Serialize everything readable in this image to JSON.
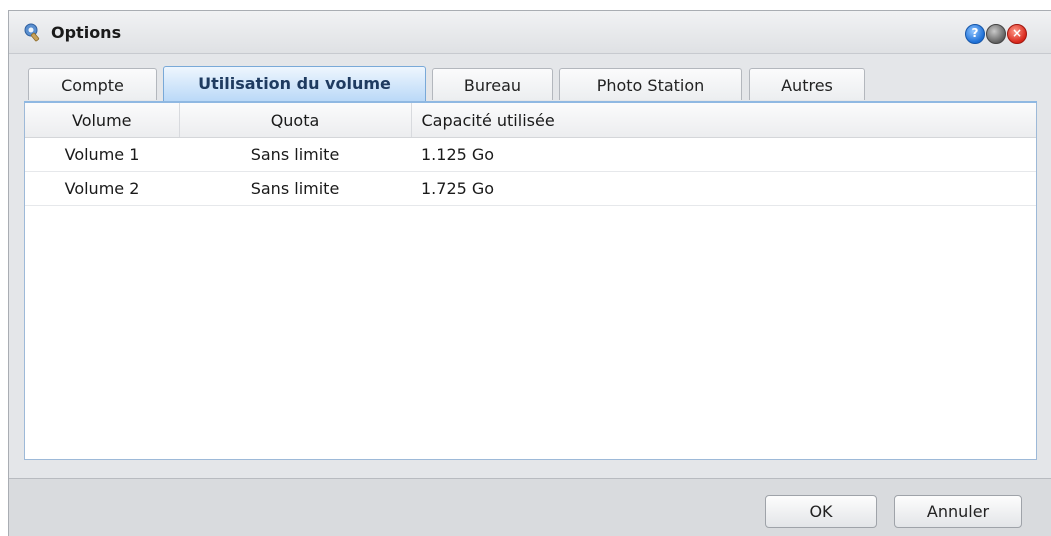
{
  "window": {
    "title": "Options",
    "help_glyph": "?",
    "close_glyph": "×"
  },
  "tabs": [
    {
      "label": "Compte",
      "active": false
    },
    {
      "label": "Utilisation du volume",
      "active": true
    },
    {
      "label": "Bureau",
      "active": false
    },
    {
      "label": "Photo Station",
      "active": false
    },
    {
      "label": "Autres",
      "active": false
    }
  ],
  "table": {
    "headers": [
      "Volume",
      "Quota",
      "Capacité utilisée"
    ],
    "rows": [
      [
        "Volume 1",
        "Sans limite",
        "1.125 Go"
      ],
      [
        "Volume 2",
        "Sans limite",
        "1.725 Go"
      ]
    ]
  },
  "footer": {
    "ok_label": "OK",
    "cancel_label": "Annuler"
  },
  "colors": {
    "active_tab": "#b9d8f7",
    "close_button": "#d8261a",
    "help_button": "#1d6fd6"
  }
}
